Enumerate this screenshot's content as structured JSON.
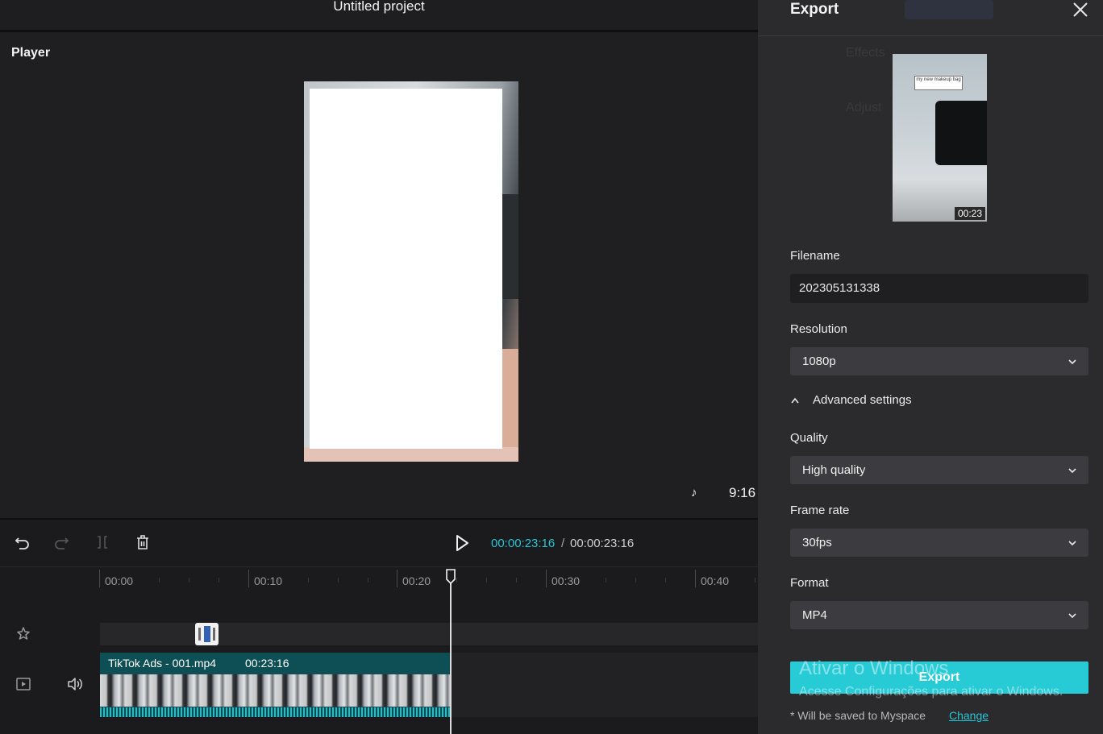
{
  "topbar": {
    "project_title": "Untitled project"
  },
  "player": {
    "label": "Player",
    "aspect_ratio": "9:16",
    "platform_icon": "tiktok-icon"
  },
  "toolbar": {
    "current_time": "00:00:23:16",
    "separator": "/",
    "total_time": "00:00:23:16",
    "icons": [
      "undo-icon",
      "redo-icon",
      "split-icon",
      "delete-icon",
      "play-icon"
    ]
  },
  "timeline": {
    "ruler": [
      "00:00",
      "00:10",
      "00:20",
      "00:30",
      "00:40"
    ],
    "clip": {
      "name": "TikTok Ads - 001.mp4",
      "duration": "00:23:16"
    },
    "track_icons": [
      "effects-track-icon",
      "video-track-icon",
      "volume-icon"
    ]
  },
  "export": {
    "title": "Export",
    "preview_duration": "00:23",
    "preview_sticker": "my new makeup bag",
    "filename_label": "Filename",
    "filename_value": "202305131338",
    "resolution_label": "Resolution",
    "resolution_value": "1080p",
    "advanced_label": "Advanced settings",
    "quality_label": "Quality",
    "quality_value": "High quality",
    "framerate_label": "Frame rate",
    "framerate_value": "30fps",
    "format_label": "Format",
    "format_value": "MP4",
    "export_button": "Export",
    "save_note": "* Will be saved to Myspace",
    "change_link": "Change",
    "ghost_effects": "Effects",
    "ghost_adjust": "Adjust"
  },
  "windows_watermark": {
    "line1": "Ativar o Windows",
    "line2": "Acesse Configurações para ativar o Windows."
  },
  "colors": {
    "accent": "#27c6d4",
    "button": "#27cbd6",
    "panel": "#2b2b2e",
    "background": "#1b1b1d"
  }
}
